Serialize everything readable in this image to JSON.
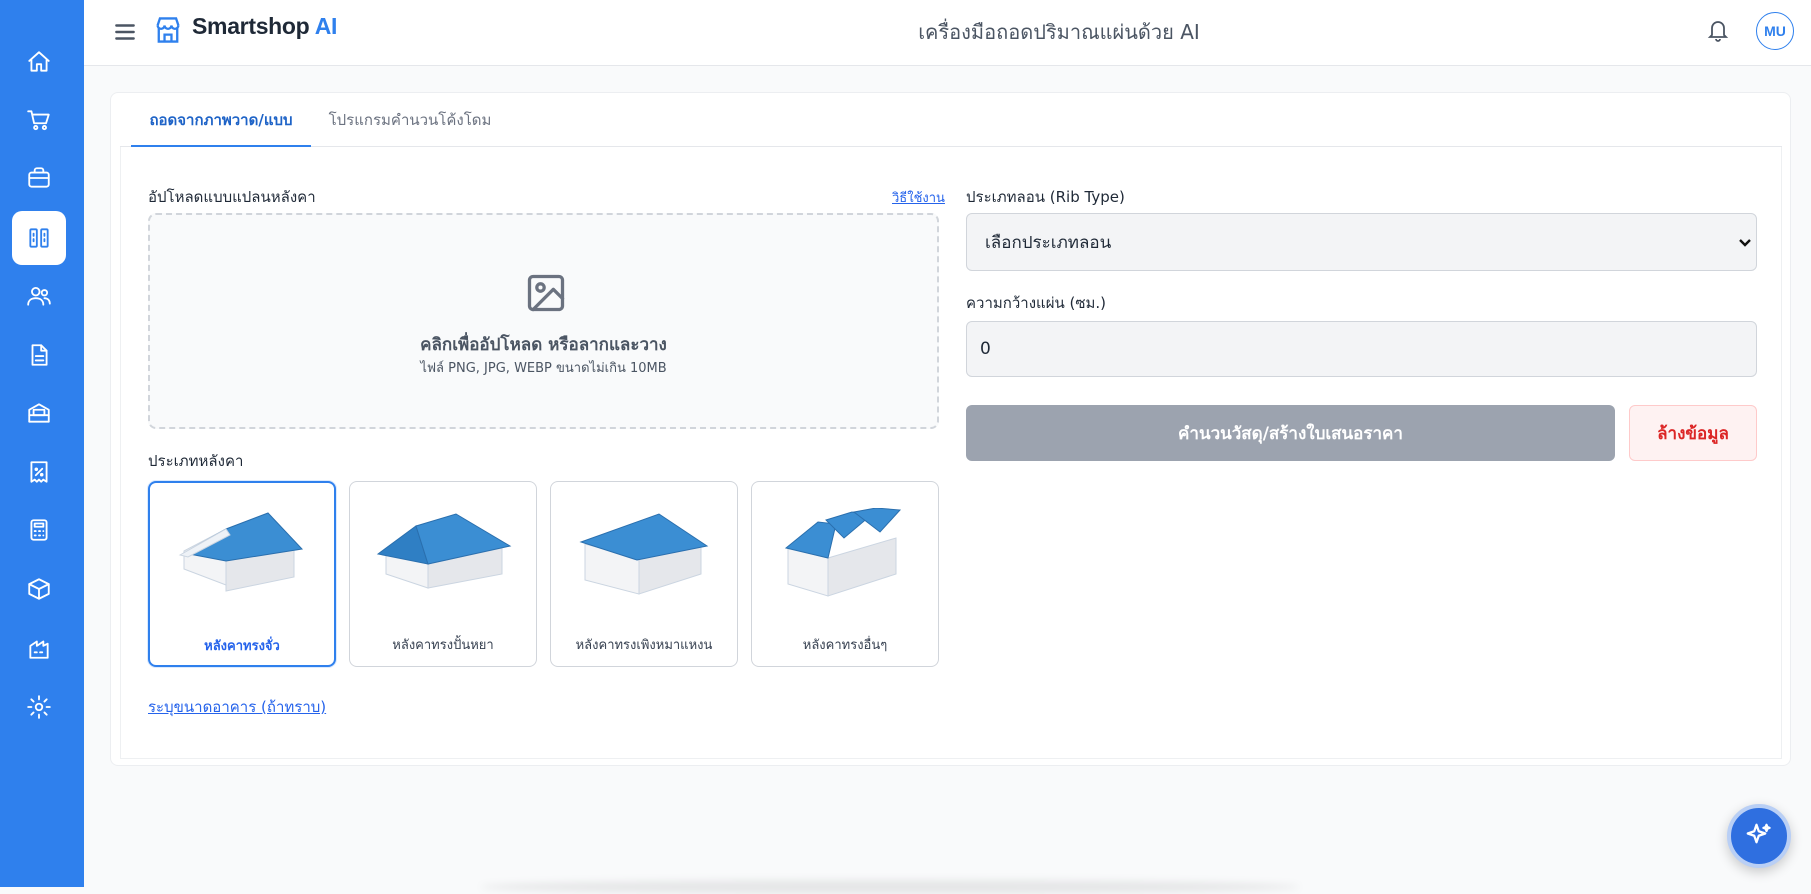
{
  "app": {
    "brand_name": "Smartshop",
    "brand_suffix": "AI",
    "page_title": "เครื่องมือถอดปริมาณแผ่นด้วย AI",
    "avatar_initials": "MU",
    "accent_color": "#2f80ed"
  },
  "sidebar": {
    "items": [
      {
        "icon": "home-icon",
        "active": false
      },
      {
        "icon": "cart-icon",
        "active": false
      },
      {
        "icon": "briefcase-icon",
        "active": false
      },
      {
        "icon": "sheet-tool-icon",
        "active": true
      },
      {
        "icon": "users-icon",
        "active": false
      },
      {
        "icon": "document-icon",
        "active": false
      },
      {
        "icon": "warehouse-icon",
        "active": false
      },
      {
        "icon": "receipt-icon",
        "active": false
      },
      {
        "icon": "calculator-icon",
        "active": false
      },
      {
        "icon": "box-icon",
        "active": false
      },
      {
        "icon": "factory-icon",
        "active": false
      },
      {
        "icon": "settings-icon",
        "active": false
      }
    ]
  },
  "tabs": [
    {
      "label": "ถอดจากภาพวาด/แบบ",
      "active": true
    },
    {
      "label": "โปรแกรมคำนวนโค้งโดม",
      "active": false
    }
  ],
  "upload": {
    "label": "อัปโหลดแบบแปลนหลังคา",
    "howto_link": "วิธีใช้งาน",
    "drop_title": "คลิกเพื่ออัปโหลด หรือลากและวาง",
    "drop_subtitle": "ไฟล์ PNG, JPG, WEBP ขนาดไม่เกิน 10MB"
  },
  "roof_types": {
    "label": "ประเภทหลังคา",
    "options": [
      {
        "name": "หลังคาทรงจั่ว",
        "selected": true
      },
      {
        "name": "หลังคาทรงปั้นหยา",
        "selected": false
      },
      {
        "name": "หลังคาทรงเพิงหมาแหงน",
        "selected": false
      },
      {
        "name": "หลังคาทรงอื่นๆ",
        "selected": false
      }
    ]
  },
  "building_size_link": "ระบุขนาดอาคาร (ถ้าทราบ)",
  "rib_type": {
    "label": "ประเภทลอน (Rib Type)",
    "selected": "เลือกประเภทลอน"
  },
  "sheet_width": {
    "label": "ความกว้างแผ่น (ซม.)",
    "value": "0"
  },
  "actions": {
    "calculate": "คำนวนวัสดุ/สร้างใบเสนอราคา",
    "clear": "ล้างข้อมูล"
  }
}
